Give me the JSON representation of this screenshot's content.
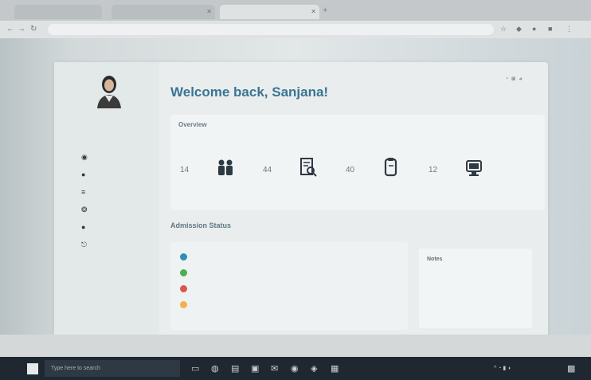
{
  "browser": {
    "tabs": [
      "",
      "",
      ""
    ],
    "address": "",
    "new_tab_icon": "plus-icon"
  },
  "profile": {
    "name": "",
    "role": ""
  },
  "sidebar": {
    "items": [
      {
        "icon": "dashboard-icon",
        "label": ""
      },
      {
        "icon": "user-icon",
        "label": ""
      },
      {
        "icon": "book-icon",
        "label": ""
      },
      {
        "icon": "settings-icon",
        "label": ""
      },
      {
        "icon": "info-icon",
        "label": ""
      },
      {
        "icon": "logout-icon",
        "label": ""
      }
    ]
  },
  "header": {
    "title": "Welcome back, Sanjana!",
    "subtitle": ""
  },
  "overview": {
    "title": "Overview",
    "subtitle": "",
    "stats": [
      {
        "label": "",
        "value": "14",
        "icon": "people-icon"
      },
      {
        "label": "",
        "value": "44",
        "icon": "document-search-icon"
      },
      {
        "label": "",
        "value": "40",
        "icon": "clipboard-icon"
      },
      {
        "label": "",
        "value": "12",
        "icon": "computer-icon"
      }
    ]
  },
  "admissions": {
    "title": "Admission Status",
    "subtitle": "",
    "items": [
      {
        "text": "",
        "color": "#2f8fb0"
      },
      {
        "text": "",
        "color": "#4caf50"
      },
      {
        "text": "",
        "color": "#e0534b"
      },
      {
        "text": "",
        "color": "#f0b24a"
      }
    ]
  },
  "side_panel": {
    "title": "Notes",
    "items": [
      "",
      "",
      ""
    ]
  },
  "status_bar": {
    "left": "",
    "middle": ""
  },
  "taskbar": {
    "search_placeholder": "Type here to search"
  }
}
